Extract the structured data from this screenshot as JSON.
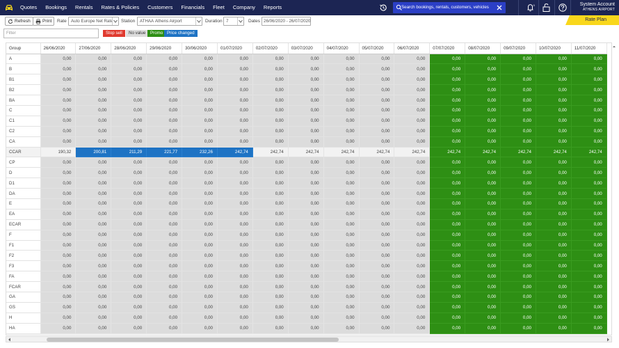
{
  "nav": {
    "items": [
      "Quotes",
      "Bookings",
      "Rentals",
      "Rates & Policies",
      "Customers",
      "Financials",
      "Fleet",
      "Company",
      "Reports"
    ],
    "search_placeholder": "Search bookings, rentals, customers, vehicles",
    "notification_count": "0",
    "account_name": "System Account",
    "account_location": "ATHENS AIRPORT",
    "bg_color": "#1c2553",
    "search_color": "#2b3fc6"
  },
  "page_tab": "Rate Plan",
  "toolbar": {
    "refresh_label": "Refresh",
    "print_label": "Print",
    "rate_label": "Rate",
    "rate_value": "Auto Europe Net Rates",
    "station_label": "Station",
    "station_code": "ATHAA",
    "station_name": "Athens Airport",
    "duration_label": "Duration",
    "duration_value": "7",
    "dates_label": "Dates",
    "dates_value": "26/06/2020 - 26/07/2020"
  },
  "filter_placeholder": "Filter",
  "legend": [
    {
      "label": "Stop sell",
      "color": "#e03a2f"
    },
    {
      "label": "No value",
      "color": "#dcdcdc"
    },
    {
      "label": "Promo",
      "color": "#2e8f14"
    },
    {
      "label": "Price changed",
      "color": "#1e73c4"
    }
  ],
  "grid": {
    "group_header": "Group",
    "dates": [
      "26/06/2020",
      "27/06/2020",
      "28/06/2020",
      "29/06/2020",
      "30/06/2020",
      "01/07/2020",
      "02/07/2020",
      "03/07/2020",
      "04/07/2020",
      "05/07/2020",
      "06/07/2020",
      "07/07/2020",
      "08/07/2020",
      "09/07/2020",
      "10/07/2020",
      "11/07/2020"
    ],
    "groups": [
      "A",
      "B",
      "B1",
      "B2",
      "BA",
      "C",
      "C1",
      "C2",
      "CA",
      "CCAR",
      "CP",
      "D",
      "D1",
      "DA",
      "E",
      "EA",
      "ECAR",
      "F",
      "F1",
      "F2",
      "F3",
      "FA",
      "FCAR",
      "GA",
      "GS",
      "H",
      "HA"
    ],
    "default_value": "0,00",
    "promo_from_index": 11,
    "highlight_row": "CCAR",
    "highlight_values": [
      "190,32",
      "200,81",
      "211,29",
      "221,77",
      "232,26",
      "242,74",
      "242,74",
      "242,74",
      "242,74",
      "242,74",
      "242,74",
      "242,74",
      "242,74",
      "242,74",
      "242,74",
      "242,74"
    ],
    "price_changed_indices": [
      1,
      2,
      3,
      4,
      5
    ]
  }
}
